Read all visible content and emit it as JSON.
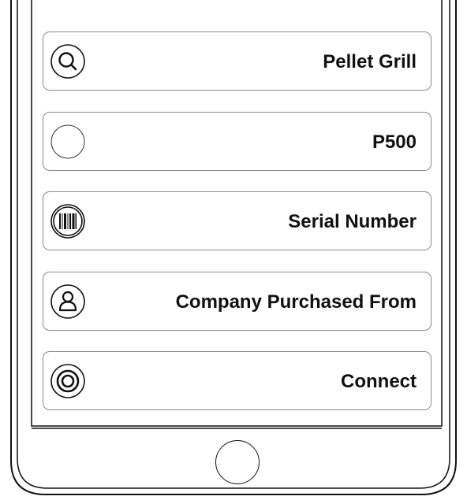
{
  "items": [
    {
      "label": "Pellet Grill",
      "icon": "search-icon"
    },
    {
      "label": "P500",
      "icon": "blank-circle-icon"
    },
    {
      "label": "Serial Number",
      "icon": "barcode-icon"
    },
    {
      "label": "Company Purchased From",
      "icon": "user-icon"
    },
    {
      "label": "Connect",
      "icon": "connect-target-icon"
    }
  ],
  "home_button": {
    "icon": "home-button"
  }
}
